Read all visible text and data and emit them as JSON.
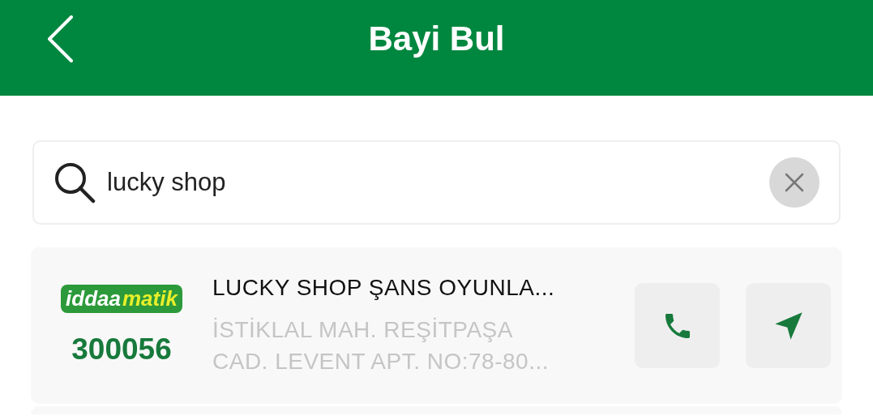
{
  "header": {
    "title": "Bayi Bul"
  },
  "search": {
    "value": "lucky shop"
  },
  "results": [
    {
      "logo": [
        "iddaa",
        "matik"
      ],
      "code": "300056",
      "name": "LUCKY SHOP ŞANS OYUNLA...",
      "address": [
        "İSTİKLAL MAH. REŞİTPAŞA",
        "CAD. LEVENT APT. NO:78-80..."
      ]
    }
  ]
}
